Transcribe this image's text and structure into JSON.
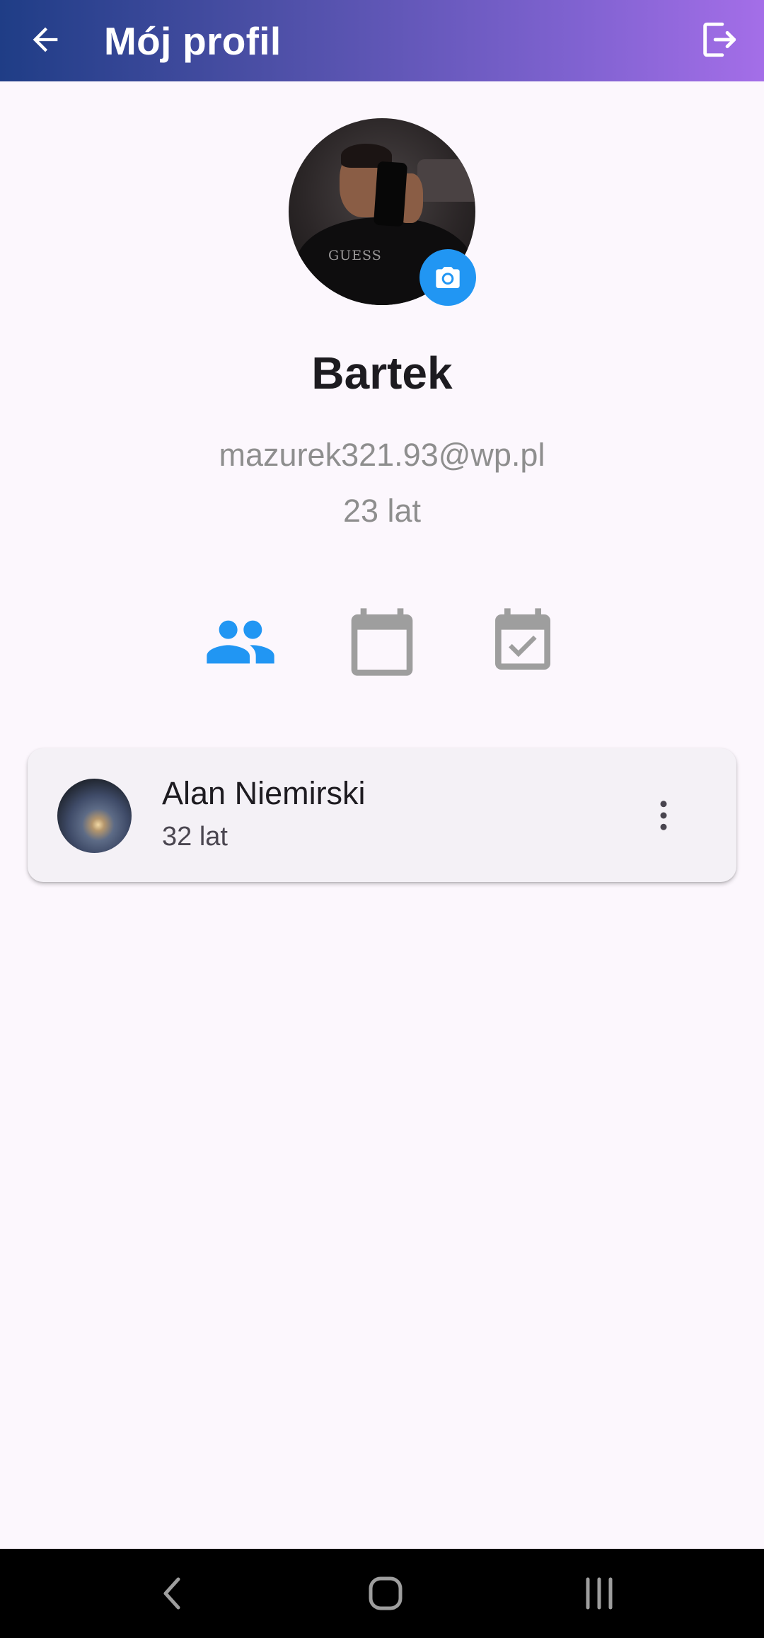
{
  "appbar": {
    "title": "Mój profil",
    "back_icon": "arrow-back-icon",
    "logout_icon": "logout-icon",
    "gradient_start": "#1f3d86",
    "gradient_end": "#a46ee8"
  },
  "profile": {
    "name": "Bartek",
    "email": "mazurek321.93@wp.pl",
    "age": "23 lat",
    "shirt_text": "GUESS",
    "camera_icon": "camera-icon",
    "camera_badge_color": "#2196f3"
  },
  "tabs": [
    {
      "icon": "people-icon",
      "selected": true,
      "color": "#2196f3"
    },
    {
      "icon": "calendar-icon",
      "selected": false,
      "color": "#9e9e9e"
    },
    {
      "icon": "calendar-check-icon",
      "selected": false,
      "color": "#9e9e9e"
    }
  ],
  "friends": [
    {
      "name": "Alan Niemirski",
      "age": "32 lat",
      "menu_icon": "more-vert-icon"
    }
  ],
  "system_nav": {
    "buttons": [
      "back-icon",
      "home-icon",
      "recents-icon"
    ]
  }
}
